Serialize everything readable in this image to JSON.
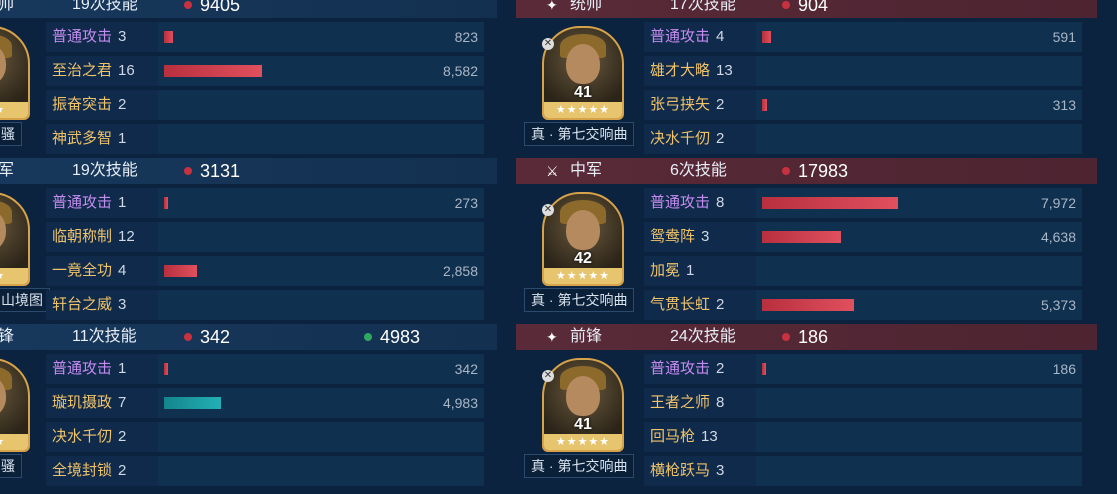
{
  "left": [
    {
      "role": "帅",
      "casts": "19次技能",
      "total": "9405",
      "tag": "骚",
      "skills": [
        {
          "name": "普通攻击",
          "count": "3",
          "value": "823",
          "frac": 0.03,
          "atk": true
        },
        {
          "name": "至治之君",
          "count": "16",
          "value": "8,582",
          "frac": 0.31
        },
        {
          "name": "振奋突击",
          "count": "2",
          "value": "",
          "frac": 0
        },
        {
          "name": "神武多智",
          "count": "1",
          "value": "",
          "frac": 0
        }
      ]
    },
    {
      "role": "军",
      "casts": "19次技能",
      "total": "3131",
      "tag": "山境图",
      "skills": [
        {
          "name": "普通攻击",
          "count": "1",
          "value": "273",
          "frac": 0.01,
          "atk": true
        },
        {
          "name": "临朝称制",
          "count": "12",
          "value": "",
          "frac": 0
        },
        {
          "name": "一竟全功",
          "count": "4",
          "value": "2,858",
          "frac": 0.105
        },
        {
          "name": "轩台之威",
          "count": "3",
          "value": "",
          "frac": 0
        }
      ]
    },
    {
      "role": "锋",
      "casts": "11次技能",
      "total": "342",
      "heal": "4983",
      "tag": "骚",
      "skills": [
        {
          "name": "普通攻击",
          "count": "1",
          "value": "342",
          "frac": 0.013,
          "atk": true
        },
        {
          "name": "璇玑摄政",
          "count": "7",
          "value": "4,983",
          "frac": 0.18,
          "teal": true
        },
        {
          "name": "决水千仞",
          "count": "2",
          "value": "",
          "frac": 0
        },
        {
          "name": "全境封锁",
          "count": "2",
          "value": "",
          "frac": 0
        }
      ]
    }
  ],
  "right": [
    {
      "role": "统帅",
      "icon": "✦",
      "casts": "17次技能",
      "total": "904",
      "level": "41",
      "stars": "★★★★★",
      "tag": "真 · 第七交响曲",
      "skills": [
        {
          "name": "普通攻击",
          "count": "4",
          "value": "591",
          "frac": 0.03,
          "atk": true
        },
        {
          "name": "雄才大略",
          "count": "13",
          "value": "",
          "frac": 0
        },
        {
          "name": "张弓挟矢",
          "count": "2",
          "value": "313",
          "frac": 0.015
        },
        {
          "name": "决水千仞",
          "count": "2",
          "value": "",
          "frac": 0
        }
      ]
    },
    {
      "role": "中军",
      "icon": "⚔",
      "casts": "6次技能",
      "total": "17983",
      "level": "42",
      "stars": "★★★★★",
      "tag": "真 · 第七交响曲",
      "skills": [
        {
          "name": "普通攻击",
          "count": "8",
          "value": "7,972",
          "frac": 0.43,
          "atk": true
        },
        {
          "name": "鸳鸯阵",
          "count": "3",
          "value": "4,638",
          "frac": 0.25
        },
        {
          "name": "加冕",
          "count": "1",
          "value": "",
          "frac": 0
        },
        {
          "name": "气贯长虹",
          "count": "2",
          "value": "5,373",
          "frac": 0.29
        }
      ]
    },
    {
      "role": "前锋",
      "icon": "✦",
      "casts": "24次技能",
      "total": "186",
      "level": "41",
      "stars": "★★★★★",
      "tag": "真 · 第七交响曲",
      "skills": [
        {
          "name": "普通攻击",
          "count": "2",
          "value": "186",
          "frac": 0.01,
          "atk": true
        },
        {
          "name": "王者之师",
          "count": "8",
          "value": "",
          "frac": 0
        },
        {
          "name": "回马枪",
          "count": "13",
          "value": "",
          "frac": 0
        },
        {
          "name": "横枪跃马",
          "count": "3",
          "value": "",
          "frac": 0
        }
      ]
    }
  ],
  "colors": {
    "damage_dot": "#c8313f",
    "heal_dot": "#2fa860",
    "atk_label": "#c48cf0",
    "skill_label": "#f0c36b"
  }
}
